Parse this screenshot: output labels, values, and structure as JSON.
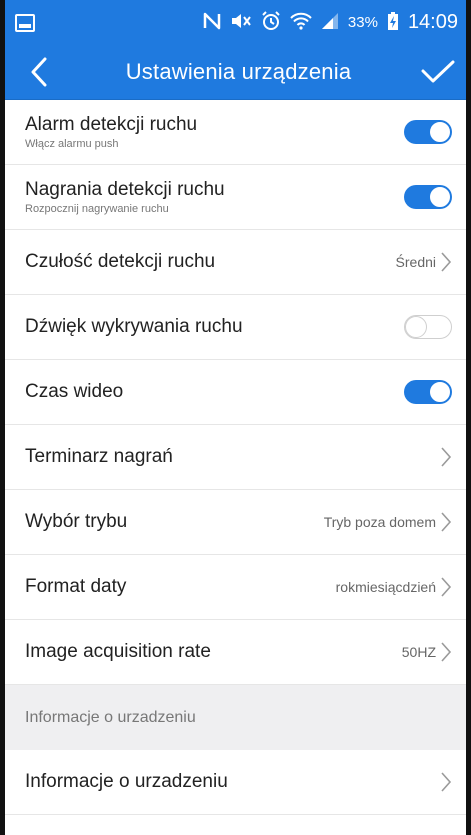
{
  "status_bar": {
    "battery_percent": "33%",
    "time": "14:09",
    "icons": [
      "notification-icon",
      "nfc-icon",
      "mute-icon",
      "alarm-icon",
      "wifi-icon",
      "signal-icon",
      "battery-charging-icon"
    ]
  },
  "app_bar": {
    "title": "Ustawienia urządzenia",
    "back_icon": "back-arrow-icon",
    "confirm_icon": "checkmark-icon"
  },
  "settings": [
    {
      "title": "Alarm detekcji ruchu",
      "subtitle": "Włącz alarmu push",
      "control": "toggle",
      "state": "on"
    },
    {
      "title": "Nagrania detekcji ruchu",
      "subtitle": "Rozpocznij nagrywanie ruchu",
      "control": "toggle",
      "state": "on"
    },
    {
      "title": "Czułość detekcji ruchu",
      "value": "Średni",
      "control": "chevron"
    },
    {
      "title": "Dźwięk wykrywania ruchu",
      "control": "toggle",
      "state": "off"
    },
    {
      "title": "Czas wideo",
      "control": "toggle",
      "state": "on"
    },
    {
      "title": "Terminarz nagrań",
      "value": "",
      "control": "chevron"
    },
    {
      "title": "Wybór trybu",
      "value": "Tryb poza domem",
      "control": "chevron"
    },
    {
      "title": "Format daty",
      "value": "rokmiesiącdzień",
      "control": "chevron"
    },
    {
      "title": "Image acquisition rate",
      "value": "50HZ",
      "control": "chevron"
    }
  ],
  "device_info_section": {
    "header": "Informacje o urzadzeniu",
    "items": [
      {
        "title": "Informacje o urzadzeniu",
        "control": "chevron"
      }
    ]
  },
  "colors": {
    "accent": "#1f7adf",
    "section_bg": "#efeff1"
  }
}
